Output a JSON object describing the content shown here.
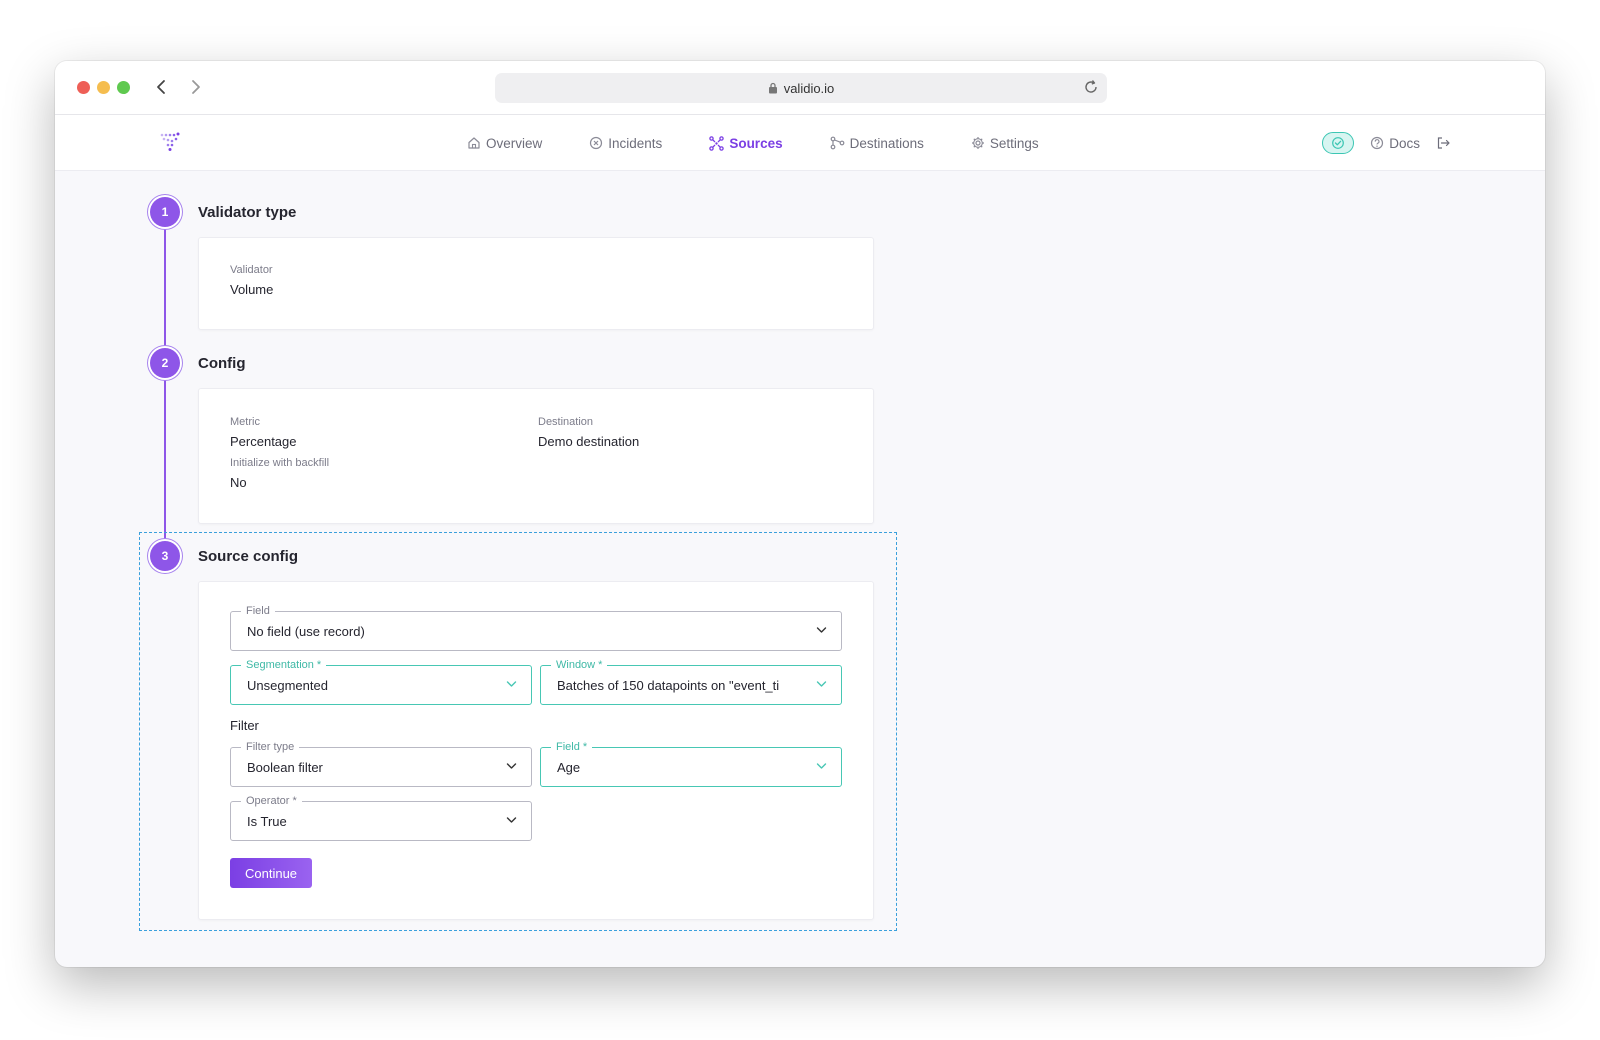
{
  "browser": {
    "url": "validio.io"
  },
  "nav": {
    "items": [
      {
        "label": "Overview",
        "icon": "home-icon"
      },
      {
        "label": "Incidents",
        "icon": "x-circle-icon"
      },
      {
        "label": "Sources",
        "icon": "graph-nodes-icon",
        "active": true
      },
      {
        "label": "Destinations",
        "icon": "share-icon"
      },
      {
        "label": "Settings",
        "icon": "gear-icon"
      }
    ],
    "docs_label": "Docs"
  },
  "steps": [
    {
      "number": "1",
      "title": "Validator type",
      "fields": [
        {
          "label": "Validator",
          "value": "Volume"
        }
      ]
    },
    {
      "number": "2",
      "title": "Config",
      "fields": [
        {
          "label": "Metric",
          "value": "Percentage"
        },
        {
          "label": "Destination",
          "value": "Demo destination"
        },
        {
          "label": "Initialize with backfill",
          "value": "No"
        }
      ]
    },
    {
      "number": "3",
      "title": "Source config",
      "form": {
        "field": {
          "label": "Field",
          "value": "No field (use record)"
        },
        "segmentation": {
          "label": "Segmentation *",
          "value": "Unsegmented"
        },
        "window": {
          "label": "Window *",
          "value": "Batches of 150 datapoints on \"event_ti"
        },
        "filter_heading": "Filter",
        "filter_type": {
          "label": "Filter type",
          "value": "Boolean filter"
        },
        "filter_field": {
          "label": "Field *",
          "value": "Age"
        },
        "operator": {
          "label": "Operator *",
          "value": "Is True"
        },
        "continue_label": "Continue"
      }
    }
  ],
  "colors": {
    "accent": "#7b3fe4",
    "teal": "#48c7b4",
    "dashed_outline": "#3aa0dc"
  }
}
